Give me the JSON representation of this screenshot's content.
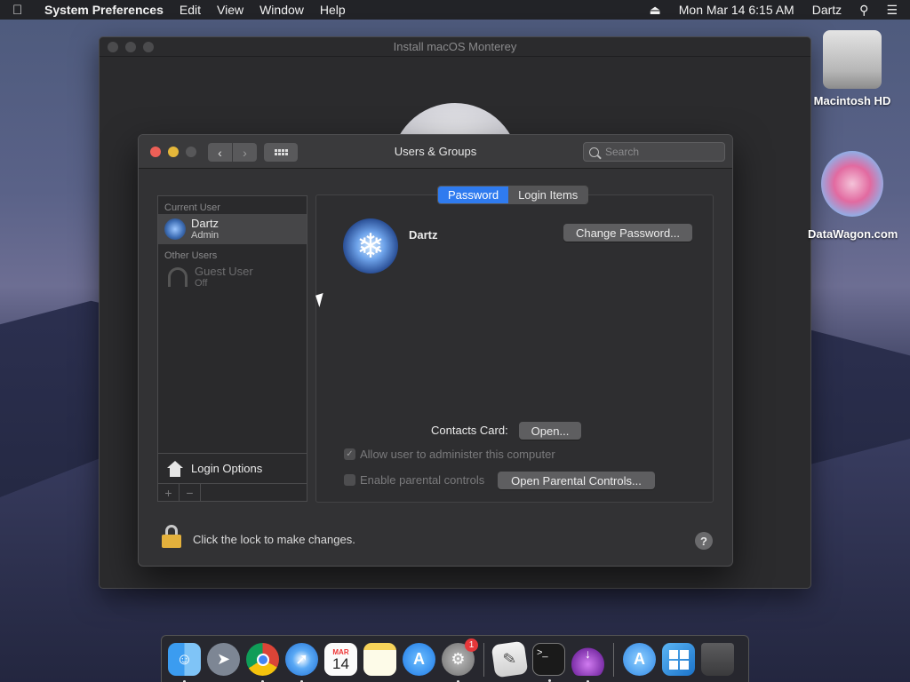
{
  "menubar": {
    "app_name": "System Preferences",
    "items": [
      "Edit",
      "View",
      "Window",
      "Help"
    ],
    "datetime": "Mon Mar 14  6:15 AM",
    "user": "Dartz"
  },
  "installer_window": {
    "title": "Install macOS Monterey"
  },
  "window": {
    "title": "Users & Groups",
    "search_placeholder": "Search"
  },
  "sidebar": {
    "current_user_header": "Current User",
    "current_user": {
      "name": "Dartz",
      "role": "Admin"
    },
    "other_users_header": "Other Users",
    "other_user": {
      "name": "Guest User",
      "status": "Off"
    },
    "login_options": "Login Options",
    "add_label": "+",
    "remove_label": "−"
  },
  "tabs": [
    {
      "label": "Password",
      "active": true
    },
    {
      "label": "Login Items",
      "active": false
    }
  ],
  "content": {
    "user_name": "Dartz",
    "change_password": "Change Password...",
    "contacts_card_label": "Contacts Card:",
    "open_button": "Open...",
    "allow_admin": "Allow user to administer this computer",
    "allow_admin_checked": true,
    "parental_controls": "Enable parental controls",
    "parental_controls_checked": false,
    "open_parental_controls": "Open Parental Controls..."
  },
  "footer": {
    "lock_text": "Click the lock to make changes.",
    "help": "?"
  },
  "desktop": {
    "hd_label": "Macintosh HD",
    "web_label": "DataWagon.com"
  },
  "dock": {
    "calendar_month": "MAR",
    "calendar_day": "14",
    "sys_prefs_badge": "1"
  },
  "colors": {
    "accent": "#2f7bef",
    "close": "#ec5f57",
    "minimize": "#e4b73a",
    "lock": "#e4b13c"
  }
}
